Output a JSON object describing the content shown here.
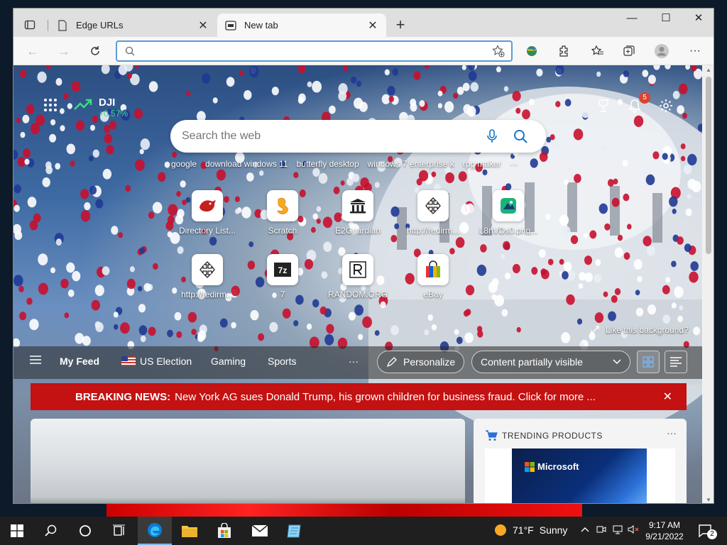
{
  "browser": {
    "tabs": [
      {
        "title": "Edge URLs",
        "icon": "page-icon",
        "active": false
      },
      {
        "title": "New tab",
        "icon": "newtab-icon",
        "active": true
      }
    ],
    "address": {
      "value": "",
      "placeholder": ""
    }
  },
  "newtab": {
    "stock": {
      "symbol": "DJI",
      "change": "+0.57%"
    },
    "notifications_count": "5",
    "search": {
      "placeholder": "Search the web"
    },
    "suggestions": [
      "google",
      "download windows 11",
      "butterfly desktop",
      "windows 7 enterprise k",
      "rpg maker"
    ],
    "tiles": [
      {
        "label": "Directory List...",
        "icon": "red-bird-icon"
      },
      {
        "label": "Scratch",
        "icon": "scratch-icon"
      },
      {
        "label": "E2Guardian",
        "icon": "bank-icon"
      },
      {
        "label": "http://redirm...",
        "icon": "move-arrows-icon"
      },
      {
        "label": "L8nVDs0.png...",
        "icon": "image-file-icon"
      },
      {
        "label": "http://redirm...",
        "icon": "move-arrows-icon"
      },
      {
        "label": "7",
        "icon": "7zip-icon"
      },
      {
        "label": "RANDOM.ORG",
        "icon": "random-org-icon"
      },
      {
        "label": "eBay",
        "icon": "ebay-bag-icon"
      }
    ],
    "like_background": "Like this background?",
    "feed": {
      "my_feed": "My Feed",
      "us_election": "US Election",
      "gaming": "Gaming",
      "sports": "Sports",
      "more": "···",
      "personalize": "Personalize",
      "content_visibility": "Content partially visible"
    },
    "breaking": {
      "label": "BREAKING NEWS:",
      "text": "New York AG sues Donald Trump, his grown children for business fraud. Click for more ..."
    },
    "trending": {
      "title": "TRENDING PRODUCTS",
      "brand": "Microsoft"
    }
  },
  "taskbar": {
    "weather": {
      "temp": "71°F",
      "condition": "Sunny"
    },
    "time": "9:17 AM",
    "date": "9/21/2022",
    "notification_count": "2"
  },
  "colors": {
    "breaking": "#c41111",
    "address_focus": "#5b9bd5",
    "stock_up": "#3ddc84",
    "taskbar": "#1f1f1f"
  }
}
